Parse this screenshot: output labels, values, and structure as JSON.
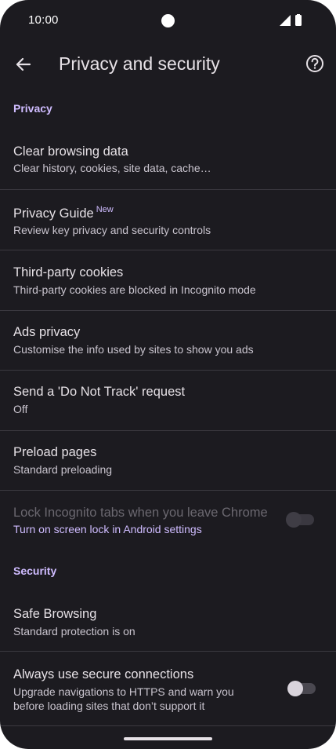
{
  "status_bar": {
    "time": "10:00"
  },
  "app_bar": {
    "title": "Privacy and security",
    "back_icon": "arrow-back-icon",
    "help_icon": "help-circle-icon"
  },
  "privacy": {
    "header": "Privacy",
    "items": [
      {
        "title": "Clear browsing data",
        "subtitle": "Clear history, cookies, site data, cache…"
      },
      {
        "title": "Privacy Guide",
        "badge": "New",
        "subtitle": "Review key privacy and security controls"
      },
      {
        "title": "Third-party cookies",
        "subtitle": "Third-party cookies are blocked in Incognito mode"
      },
      {
        "title": "Ads privacy",
        "subtitle": "Customise the info used by sites to show you ads"
      },
      {
        "title": "Send a 'Do Not Track' request",
        "subtitle": "Off"
      },
      {
        "title": "Preload pages",
        "subtitle": "Standard preloading"
      },
      {
        "title": "Lock Incognito tabs when you leave Chrome",
        "subtitle": "Turn on screen lock in Android settings",
        "toggle": "off",
        "disabled": true
      }
    ]
  },
  "security": {
    "header": "Security",
    "items": [
      {
        "title": "Safe Browsing",
        "subtitle": "Standard protection is on"
      },
      {
        "title": "Always use secure connections",
        "subtitle_line1": "Upgrade navigations to HTTPS and warn you",
        "subtitle_line2": "before loading sites that don’t support it",
        "toggle": "off"
      }
    ]
  },
  "colors": {
    "background": "#1c1b20",
    "accent": "#cfbcff",
    "text_primary": "#e6e1e6",
    "text_secondary": "#c9c4ce",
    "divider": "#3b3940"
  }
}
